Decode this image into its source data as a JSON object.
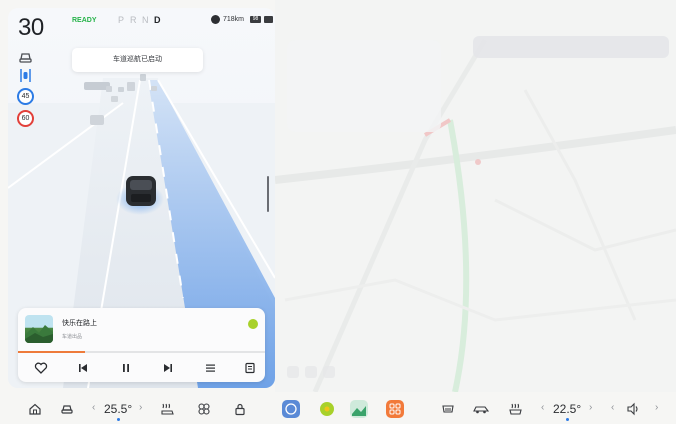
{
  "status": {
    "speed": "30",
    "ready": "READY",
    "gears": [
      "P",
      "R",
      "N",
      "D"
    ],
    "active_gear": "D",
    "range": "718km",
    "battery": "98"
  },
  "speed_limits": [
    "45",
    "60"
  ],
  "adas_toast": "车道巡航已启动",
  "music": {
    "title": "快乐在路上",
    "artist": "车道出品",
    "progress": 0.27
  },
  "climate": {
    "left_temp": "25.5°",
    "right_temp": "22.5°"
  },
  "icons": {
    "status": [
      "steering-wheel-icon",
      "lane-assist-icon"
    ],
    "music_controls": [
      "heart-icon",
      "previous-track-icon",
      "pause-icon",
      "next-track-icon",
      "playlist-icon",
      "lyrics-icon"
    ],
    "dock": [
      "home-icon",
      "car-icon",
      "seat-heat-icon",
      "fan-icon",
      "lock-icon",
      "360-camera-app-icon",
      "music-app-icon",
      "maps-app-icon",
      "apps-app-icon",
      "defrost-icon",
      "car-mode-icon",
      "rear-heat-icon",
      "volume-icon"
    ]
  },
  "colors": {
    "ready": "#27b34a",
    "lane_highlight": "#5b96e6",
    "limit_blue": "#2c7be5",
    "limit_red": "#e2403a",
    "progress": "#ee7b3b"
  }
}
